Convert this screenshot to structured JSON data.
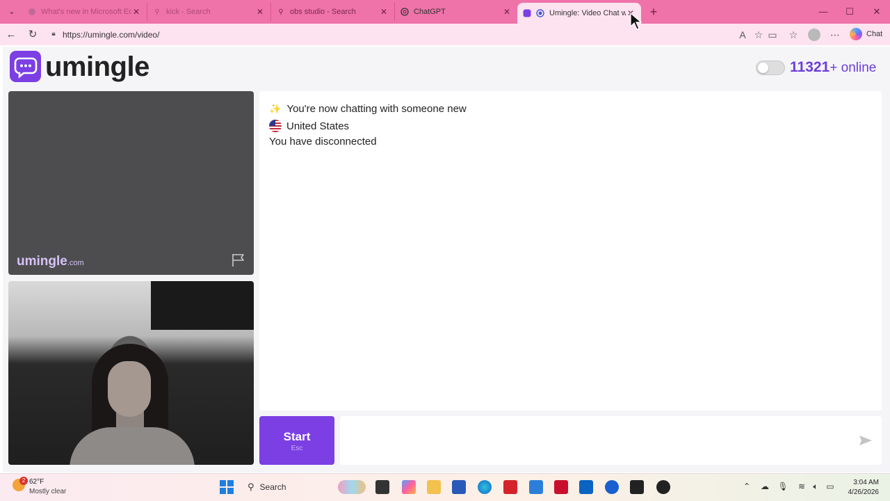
{
  "browser": {
    "tabs": [
      {
        "title": "What's new in Microsoft Edge",
        "icon": "edge-icon",
        "active": false
      },
      {
        "title": "kick - Search",
        "icon": "search-icon",
        "active": false
      },
      {
        "title": "obs studio - Search",
        "icon": "search-icon",
        "active": false
      },
      {
        "title": "ChatGPT",
        "icon": "chatgpt-icon",
        "active": false
      },
      {
        "title": "Umingle: Video Chat wit",
        "icon": "umingle-icon",
        "active": true
      }
    ],
    "new_tab_glyph": "+",
    "address": "https://umingle.com/video/",
    "copilot_label": "Chat"
  },
  "header": {
    "logo_text": "umingle",
    "online_count": "11321",
    "online_suffix": "+ online"
  },
  "remote_video": {
    "watermark_main": "umingle",
    "watermark_suffix": ".com"
  },
  "chat": {
    "messages": [
      {
        "icon": "sparkles-icon",
        "text": "You're now chatting with someone new"
      },
      {
        "icon": "us-flag-icon",
        "text": "United States"
      },
      {
        "icon": "",
        "text": "You have disconnected"
      }
    ],
    "input_placeholder": ""
  },
  "controls": {
    "start_label": "Start",
    "start_shortcut": "Esc"
  },
  "taskbar": {
    "weather_badge": "2",
    "temperature": "62°F",
    "condition": "Mostly clear",
    "search_label": "Search",
    "time": "3:04 AM",
    "date": "4/26/2026"
  },
  "colors": {
    "brand": "#7b3fe4",
    "tabstrip": "#ef72a8",
    "toolbar": "#fde3ef",
    "online_text": "#6b3fd8"
  }
}
